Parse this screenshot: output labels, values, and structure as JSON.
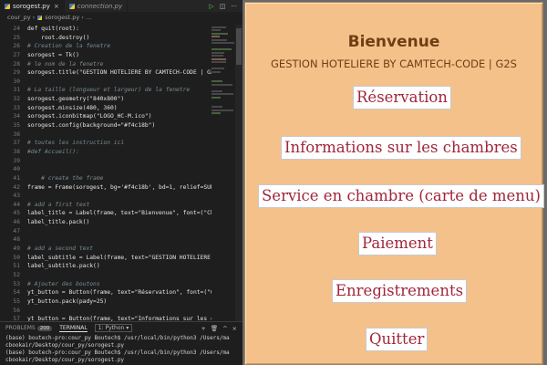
{
  "editor": {
    "tabs": [
      {
        "label": "sorogest.py",
        "active": true
      },
      {
        "label": "connection.py",
        "active": false
      }
    ],
    "breadcrumb": {
      "folder": "cour_py",
      "file": "sorogest.py"
    },
    "lines": [
      {
        "n": "24",
        "t": "def quit(root):"
      },
      {
        "n": "25",
        "t": "    root.destroy()"
      },
      {
        "n": "26",
        "t": "# Creation de la fenetre",
        "c": true
      },
      {
        "n": "27",
        "t": "sorogest = Tk()"
      },
      {
        "n": "28",
        "t": "# le nom de la fenetre",
        "c": true
      },
      {
        "n": "29",
        "t": "sorogest.title(\"GESTION HOTELIERE BY CAMTECH-CODE | G2S"
      },
      {
        "n": "30",
        "t": ""
      },
      {
        "n": "31",
        "t": "# La taille (longueur et largeur) de la fenetre",
        "c": true
      },
      {
        "n": "32",
        "t": "sorogest.geometry(\"840x800\")"
      },
      {
        "n": "33",
        "t": "sorogest.minsize(480, 360)"
      },
      {
        "n": "34",
        "t": "sorogest.iconbitmap(\"LOGO_HC-M.ico\")"
      },
      {
        "n": "35",
        "t": "sorogest.config(background=\"#f4c18b\")"
      },
      {
        "n": "36",
        "t": ""
      },
      {
        "n": "37",
        "t": "# toutes les instruction ici",
        "c": true
      },
      {
        "n": "38",
        "t": "#def Accueil():",
        "c": true
      },
      {
        "n": "39",
        "t": ""
      },
      {
        "n": "40",
        "t": ""
      },
      {
        "n": "41",
        "t": "    # create the frame",
        "c": true
      },
      {
        "n": "42",
        "t": "frame = Frame(sorogest, bg='#f4c18b', bd=1, relief=SUNK"
      },
      {
        "n": "43",
        "t": ""
      },
      {
        "n": "44",
        "t": "# add a first text",
        "c": true
      },
      {
        "n": "45",
        "t": "label_title = Label(frame, text=\"Bienvenue\", font=(\"Cha"
      },
      {
        "n": "46",
        "t": "label_title.pack()"
      },
      {
        "n": "47",
        "t": ""
      },
      {
        "n": "48",
        "t": ""
      },
      {
        "n": "49",
        "t": "# add a second text",
        "c": true
      },
      {
        "n": "50",
        "t": "label_subtitle = Label(frame, text=\"GESTION HOTELIERE B"
      },
      {
        "n": "51",
        "t": "label_subtitle.pack()"
      },
      {
        "n": "52",
        "t": ""
      },
      {
        "n": "53",
        "t": "# Ajouter des boutons",
        "c": true
      },
      {
        "n": "54",
        "t": "yt_button = Button(frame, text=\"Réservation\", font=(\"Or"
      },
      {
        "n": "55",
        "t": "yt_button.pack(pady=25)"
      },
      {
        "n": "56",
        "t": ""
      },
      {
        "n": "57",
        "t": "yt_button = Button(frame, text=\"Informations sur les ch"
      }
    ],
    "panel": {
      "problems_label": "PROBLEMS",
      "problems_count": "200",
      "terminal_label": "TERMINAL",
      "terminal_select": "1: Python",
      "terminal_lines": [
        "(base) boutech-pro:cour_py Boutech$ /usr/local/bin/python3 /Users/ma",
        "cbookair/Desktop/cour_py/sorogest.py",
        "(base) boutech-pro:cour_py Boutech$ /usr/local/bin/python3 /Users/ma",
        "cbookair/Desktop/cour_py/sorogest.py"
      ]
    }
  },
  "app": {
    "background": "#f4c18b",
    "title": "Bienvenue",
    "subtitle": "GESTION HOTELIERE BY CAMTECH-CODE | G2S",
    "button_text_color": "#a0263a",
    "buttons": [
      {
        "id": "reservation",
        "label": "Réservation"
      },
      {
        "id": "rooms",
        "label": "Informations sur les chambres"
      },
      {
        "id": "room-service",
        "label": "Service en chambre (carte de menu)"
      },
      {
        "id": "payment",
        "label": "Paiement"
      },
      {
        "id": "records",
        "label": "Enregistrements"
      },
      {
        "id": "quit",
        "label": "Quitter"
      }
    ]
  }
}
